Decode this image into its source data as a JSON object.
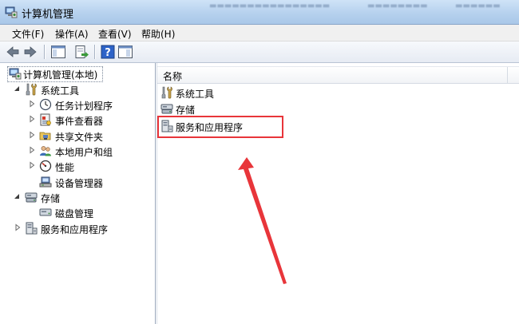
{
  "window": {
    "title": "计算机管理"
  },
  "menu": {
    "items": [
      {
        "label": "文件(F)"
      },
      {
        "label": "操作(A)"
      },
      {
        "label": "查看(V)"
      },
      {
        "label": "帮助(H)"
      }
    ]
  },
  "toolbar": {
    "buttons": [
      "back-arrow-icon",
      "forward-arrow-icon",
      "show-hide-tree-icon",
      "export-list-icon",
      "help-icon",
      "show-hide-action-pane-icon"
    ]
  },
  "tree": {
    "root": "计算机管理(本地)",
    "system_tools": "系统工具",
    "task_scheduler": "任务计划程序",
    "event_viewer": "事件查看器",
    "shared_folders": "共享文件夹",
    "local_users": "本地用户和组",
    "performance": "性能",
    "device_manager": "设备管理器",
    "storage": "存储",
    "disk_management": "磁盘管理",
    "services_apps": "服务和应用程序"
  },
  "list": {
    "header_name": "名称",
    "items": [
      "系统工具",
      "存储",
      "服务和应用程序"
    ]
  },
  "colors": {
    "annotation_red": "#e8353a",
    "titlebar_blue": "#b6d1ee"
  }
}
